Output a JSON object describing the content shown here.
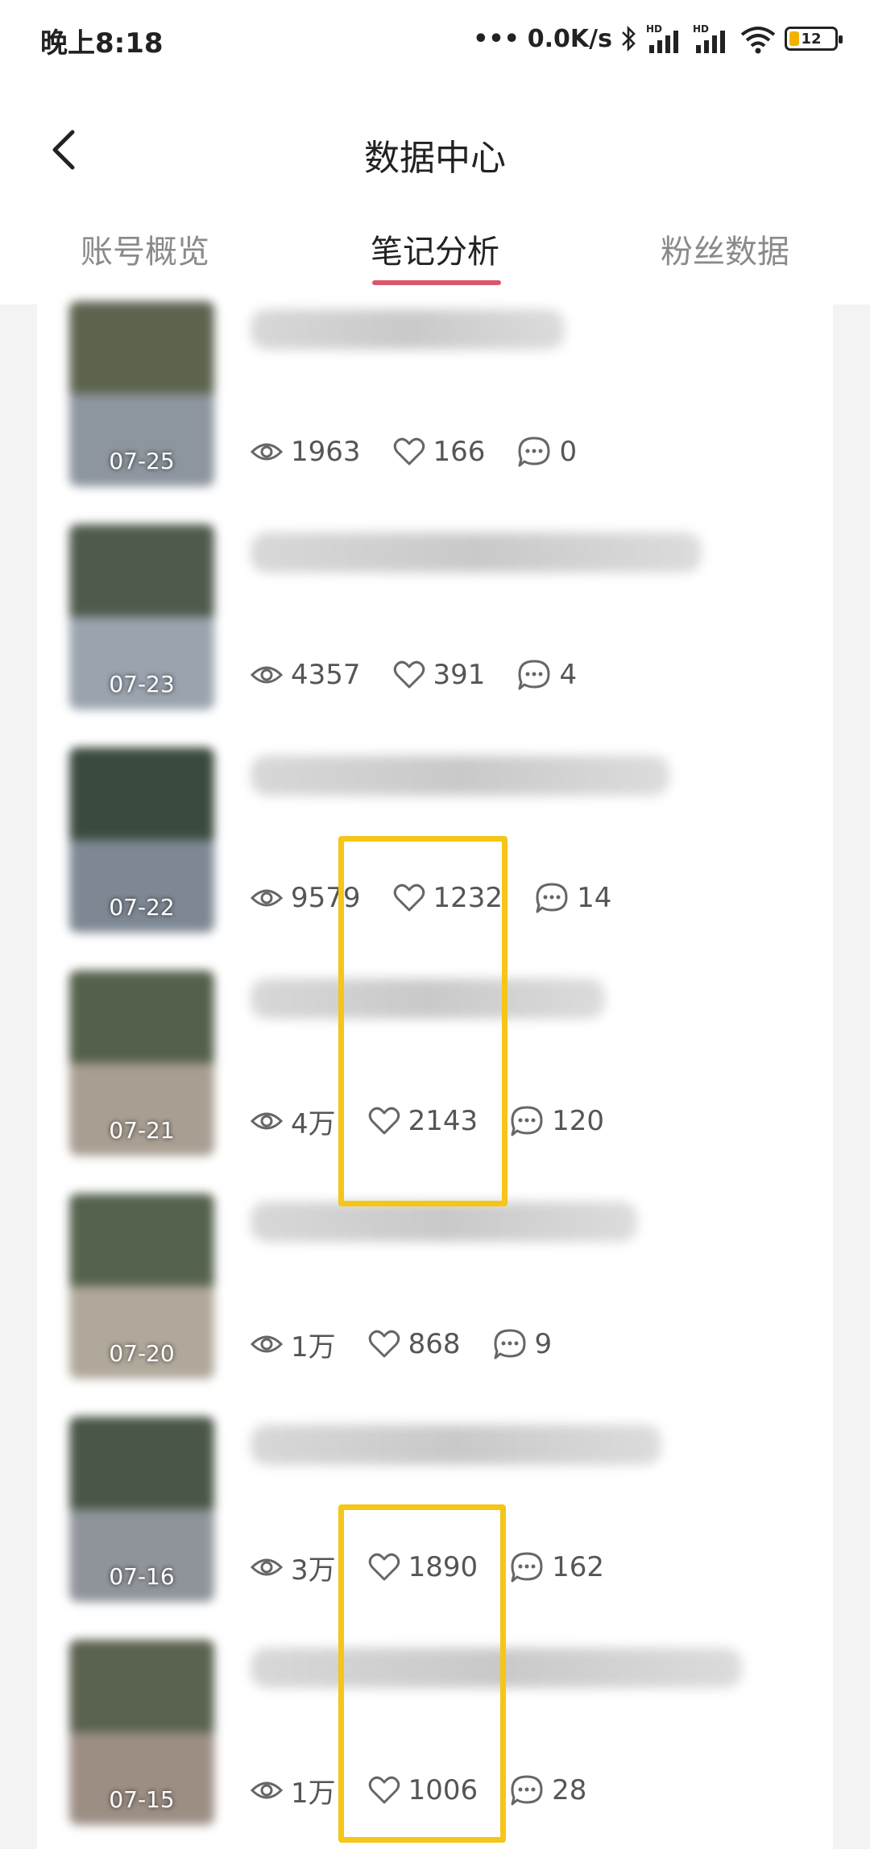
{
  "status_bar": {
    "time": "晚上8:18",
    "network_speed": "0.0K/s",
    "battery": "12"
  },
  "header": {
    "title": "数据中心",
    "back_icon": "chevron-left-icon"
  },
  "tabs": [
    {
      "label": "账号概览",
      "active": false
    },
    {
      "label": "笔记分析",
      "active": true
    },
    {
      "label": "粉丝数据",
      "active": false
    }
  ],
  "colors": {
    "accent": "#d9586c",
    "highlight": "#f5c518"
  },
  "notes": [
    {
      "date": "07-25",
      "views": "1963",
      "likes": "166",
      "comments": "0"
    },
    {
      "date": "07-23",
      "views": "4357",
      "likes": "391",
      "comments": "4"
    },
    {
      "date": "07-22",
      "views": "9579",
      "likes": "1232",
      "comments": "14"
    },
    {
      "date": "07-21",
      "views": "4万",
      "likes": "2143",
      "comments": "120"
    },
    {
      "date": "07-20",
      "views": "1万",
      "likes": "868",
      "comments": "9"
    },
    {
      "date": "07-16",
      "views": "3万",
      "likes": "1890",
      "comments": "162"
    },
    {
      "date": "07-15",
      "views": "1万",
      "likes": "1006",
      "comments": "28"
    }
  ]
}
